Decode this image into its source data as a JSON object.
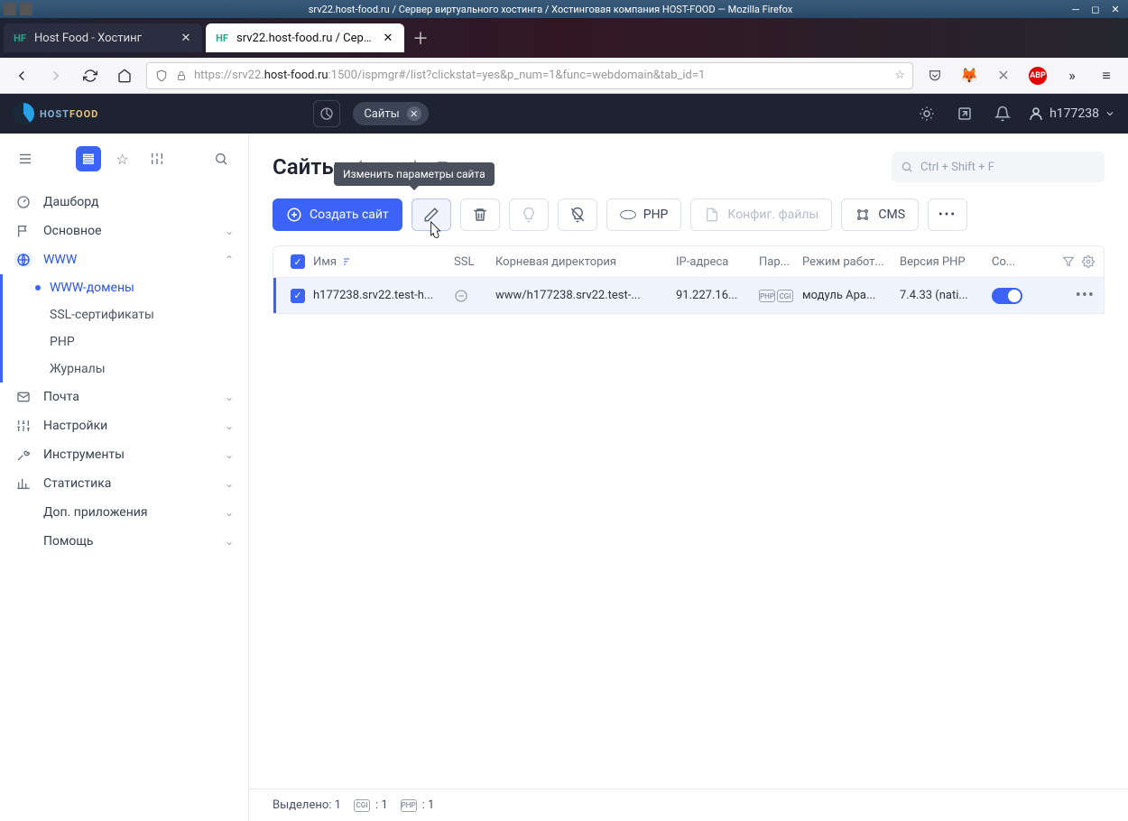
{
  "os": {
    "title": "srv22.host-food.ru / Сервер виртуального хостинга / Хостинговая компания HOST-FOOD — Mozilla Firefox"
  },
  "browser": {
    "tab1_title": "Host Food - Хостинг",
    "tab2_title": "srv22.host-food.ru / Серве",
    "url_prefix": "https://srv22.",
    "url_host": "host-food.ru",
    "url_suffix": ":1500/ispmgr#/list?clickstat=yes&p_num=1&func=webdomain&tab_id=1"
  },
  "app": {
    "logo_text_a": "HOST",
    "logo_text_b": "FOOD",
    "top_tab_label": "Сайты",
    "user_name": "h177238"
  },
  "sidebar": {
    "dashboard": "Дашборд",
    "main": "Основное",
    "www": "WWW",
    "www_items": {
      "domains": "WWW-домены",
      "ssl": "SSL-сертификаты",
      "php": "PHP",
      "logs": "Журналы"
    },
    "mail": "Почта",
    "settings": "Настройки",
    "tools": "Инструменты",
    "stats": "Статистика",
    "extras": "Доп. приложения",
    "help": "Помощь"
  },
  "page": {
    "title": "Сайты",
    "search_placeholder": "Ctrl + Shift + F"
  },
  "toolbar": {
    "create": "Создать сайт",
    "edit_tooltip": "Изменить параметры сайта",
    "php": "PHP",
    "config": "Конфиг. файлы",
    "cms": "CMS"
  },
  "table": {
    "headers": {
      "name": "Имя",
      "ssl": "SSL",
      "root": "Корневая директория",
      "ip": "IP-адреса",
      "params": "Пар...",
      "mode": "Режим работ...",
      "php": "Версия PHP",
      "state": "Со..."
    },
    "row": {
      "name": "h177238.srv22.test-h...",
      "root": "www/h177238.srv22.test-...",
      "ip": "91.227.16...",
      "mode": "модуль Apa...",
      "php": "7.4.33 (nati..."
    }
  },
  "status": {
    "selected_label": "Выделено:",
    "selected_count": "1",
    "cgi_count": ": 1",
    "php_count": ": 1"
  }
}
